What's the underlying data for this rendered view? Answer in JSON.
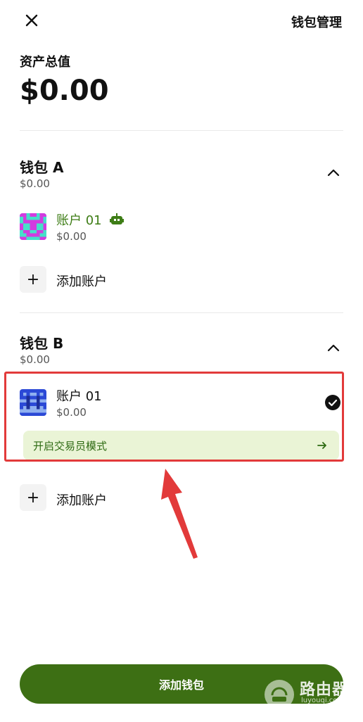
{
  "header": {
    "wallet_manage_label": "钱包管理"
  },
  "total": {
    "label": "资产总值",
    "value": "$0.00"
  },
  "wallets": [
    {
      "name": "钱包 A",
      "balance": "$0.00",
      "accounts": [
        {
          "name": "账户 01",
          "balance": "$0.00",
          "badge_icon": "robot-icon"
        }
      ],
      "add_account_label": "添加账户"
    },
    {
      "name": "钱包 B",
      "balance": "$0.00",
      "accounts": [
        {
          "name": "账户 01",
          "balance": "$0.00",
          "selected": true
        }
      ],
      "trader_mode_label": "开启交易员模式",
      "add_account_label": "添加账户"
    }
  ],
  "footer": {
    "add_wallet_label": "添加钱包"
  },
  "watermark": {
    "title": "路由器",
    "subtitle": "luyouqi.com"
  },
  "colors": {
    "brand_green": "#3d6f14",
    "accent_green_text": "#3e7d16",
    "highlight_red": "#e23a3a",
    "trader_bg": "#eaf4d6"
  }
}
